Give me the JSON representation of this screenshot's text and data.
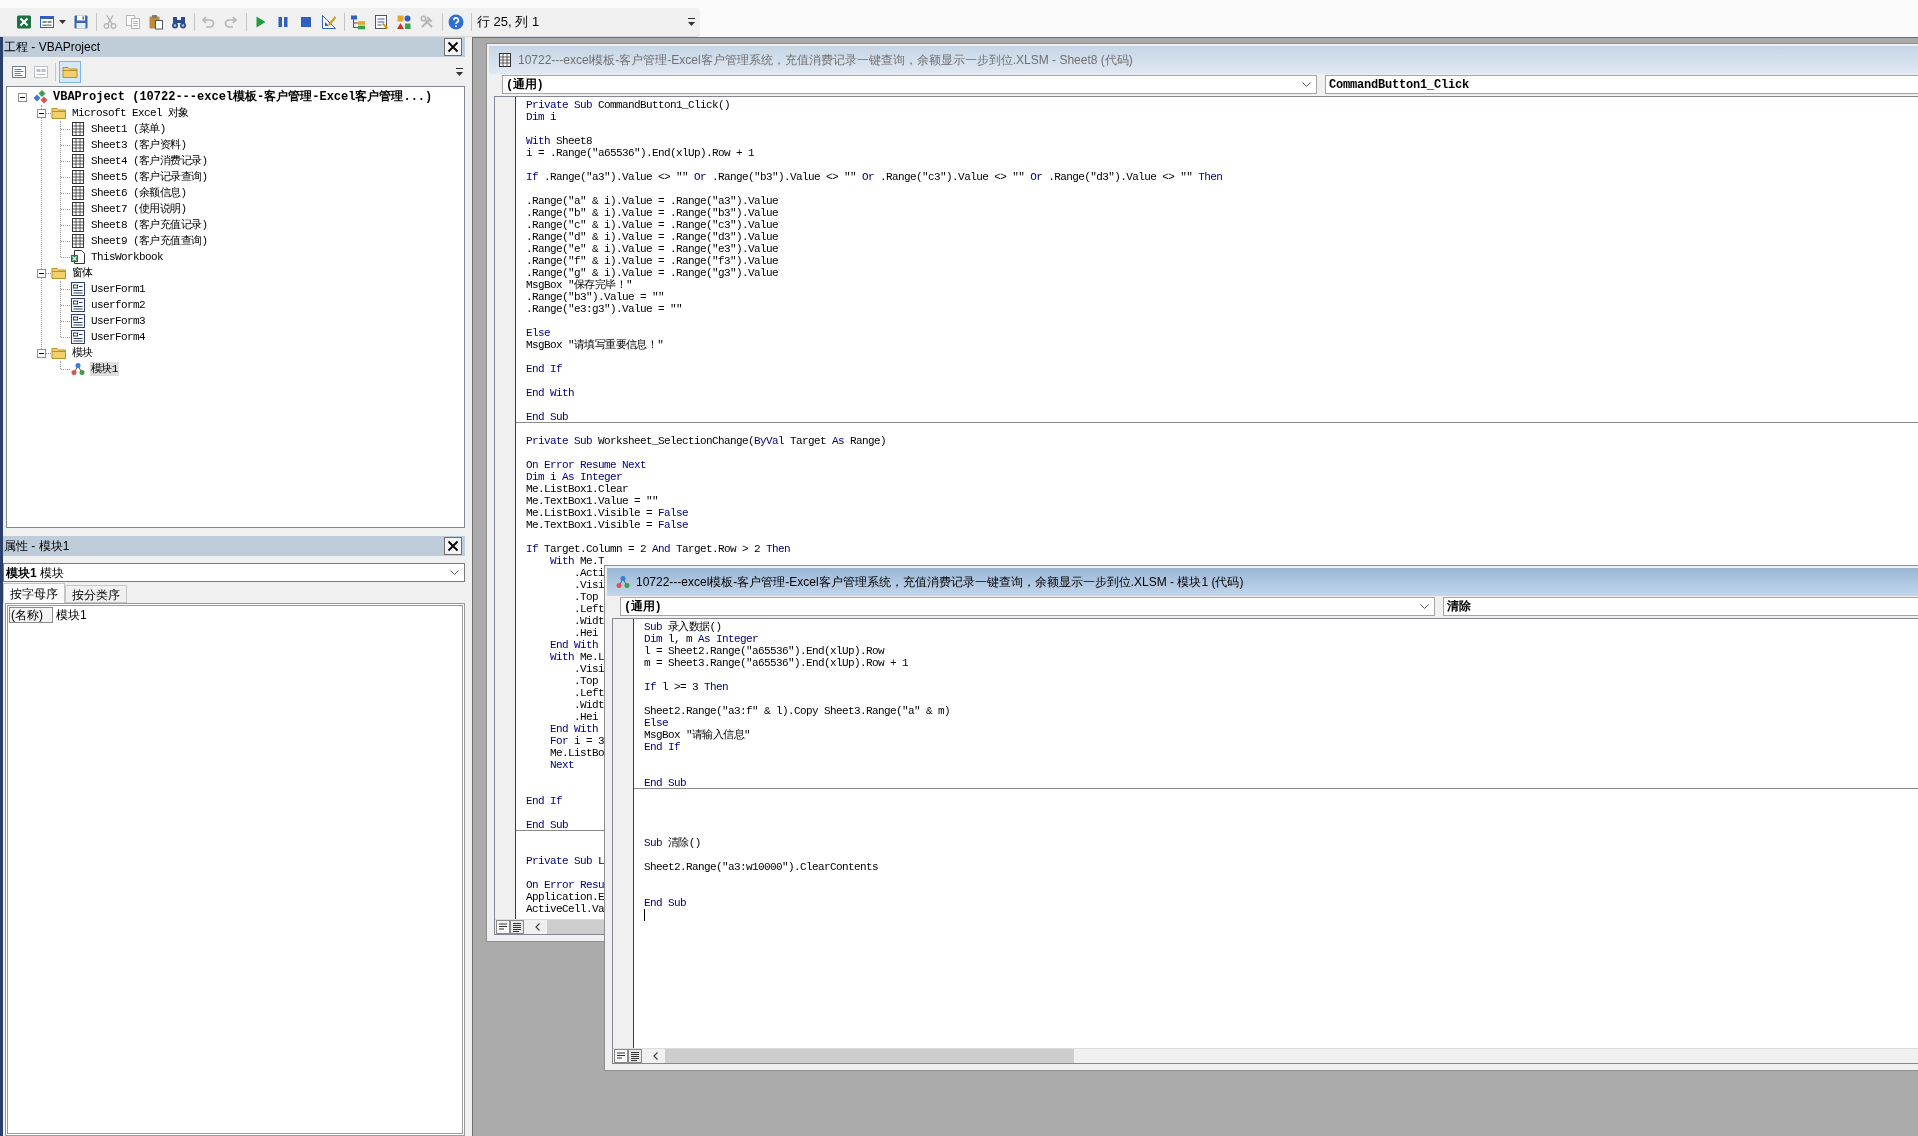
{
  "toolbar": {
    "groups": [
      {
        "buttons": [
          {
            "kind": "spreadsheet",
            "disabled": false
          },
          {
            "kind": "userform",
            "disabled": false
          },
          {
            "kind": "save",
            "disabled": false
          }
        ]
      },
      {
        "buttons": [
          {
            "kind": "cut",
            "disabled": true
          },
          {
            "kind": "copy",
            "disabled": true
          },
          {
            "kind": "paste",
            "disabled": false
          },
          {
            "kind": "find",
            "disabled": false
          }
        ]
      },
      {
        "buttons": [
          {
            "kind": "undo",
            "disabled": true
          },
          {
            "kind": "redo",
            "disabled": true
          }
        ]
      },
      {
        "buttons": [
          {
            "kind": "run",
            "disabled": false
          },
          {
            "kind": "pause",
            "disabled": false
          },
          {
            "kind": "stop",
            "disabled": false
          },
          {
            "kind": "design",
            "disabled": false
          }
        ]
      },
      {
        "buttons": [
          {
            "kind": "explorer",
            "disabled": false
          },
          {
            "kind": "properties",
            "disabled": false
          },
          {
            "kind": "browser",
            "disabled": false
          },
          {
            "kind": "toolbox",
            "disabled": true
          }
        ]
      },
      {
        "buttons": [
          {
            "kind": "help",
            "disabled": false
          }
        ]
      }
    ],
    "position": "行 25, 列 1"
  },
  "project_explorer": {
    "title": "工程 - VBAProject",
    "toolbar": [
      {
        "kind": "code",
        "disabled": false,
        "selected": false
      },
      {
        "kind": "object",
        "disabled": true,
        "selected": false
      },
      {
        "kind": "folders",
        "disabled": false,
        "selected": true
      }
    ],
    "tree": [
      {
        "kind": "project",
        "label": "VBAProject (10722---excel模板-客户管理-Excel客户管理...)",
        "selected": false,
        "expanded": true,
        "children": [
          {
            "kind": "folder",
            "label": "Microsoft Excel 对象",
            "selected": false,
            "expanded": true,
            "children": [
              {
                "kind": "sheet",
                "label": "Sheet1 (菜单)",
                "selected": false
              },
              {
                "kind": "sheet",
                "label": "Sheet3 (客户资料)",
                "selected": false
              },
              {
                "kind": "sheet",
                "label": "Sheet4 (客户消费记录)",
                "selected": false
              },
              {
                "kind": "sheet",
                "label": "Sheet5 (客户记录查询)",
                "selected": false
              },
              {
                "kind": "sheet",
                "label": "Sheet6 (余额信息)",
                "selected": false
              },
              {
                "kind": "sheet",
                "label": "Sheet7 (使用说明)",
                "selected": false
              },
              {
                "kind": "sheet",
                "label": "Sheet8 (客户充值记录)",
                "selected": false
              },
              {
                "kind": "sheet",
                "label": "Sheet9 (客户充值查询)",
                "selected": false
              },
              {
                "kind": "workbook",
                "label": "ThisWorkbook",
                "selected": false
              }
            ]
          },
          {
            "kind": "folder",
            "label": "窗体",
            "selected": false,
            "expanded": true,
            "children": [
              {
                "kind": "form",
                "label": "UserForm1",
                "selected": false
              },
              {
                "kind": "form",
                "label": "userform2",
                "selected": false
              },
              {
                "kind": "form",
                "label": "UserForm3",
                "selected": false
              },
              {
                "kind": "form",
                "label": "UserForm4",
                "selected": false
              }
            ]
          },
          {
            "kind": "folder",
            "label": "模块",
            "selected": false,
            "expanded": true,
            "children": [
              {
                "kind": "module",
                "label": "模块1",
                "selected": true
              }
            ]
          }
        ]
      }
    ]
  },
  "properties": {
    "title": "属性 - 模块1",
    "object": "**模块1** 模块",
    "tabs": [
      {
        "label": "按字母序",
        "selected": true
      },
      {
        "label": "按分类序",
        "selected": false
      }
    ],
    "rows": [
      {
        "name": "(名称)",
        "value": "模块1"
      }
    ]
  },
  "code_windows": [
    {
      "kind": "sheet",
      "title": "10722---excel模板-客户管理-Excel客户管理系统，充值消费记录一键查询，余额显示一步到位.XLSM - Sheet8 (代码)",
      "active": false,
      "object": "(通用)",
      "procedure": "CommandButton1_Click",
      "procedures": [
        {
          "lines": [
            {
              "kind": "code",
              "segments": [
                {
                  "kind": "keyword",
                  "text": "Private Sub"
                },
                {
                  "kind": "plain",
                  "text": " CommandButton1_Click()"
                }
              ]
            },
            {
              "kind": "code",
              "segments": [
                {
                  "kind": "keyword",
                  "text": "Dim"
                },
                {
                  "kind": "plain",
                  "text": " i"
                }
              ]
            },
            {
              "kind": "blank"
            },
            {
              "kind": "code",
              "segments": [
                {
                  "kind": "keyword",
                  "text": "With"
                },
                {
                  "kind": "plain",
                  "text": " Sheet8"
                }
              ]
            },
            {
              "kind": "code",
              "segments": [
                {
                  "kind": "plain",
                  "text": "i = .Range(\"a65536\").End(xlUp).Row + 1"
                }
              ]
            },
            {
              "kind": "blank"
            },
            {
              "kind": "code",
              "segments": [
                {
                  "kind": "keyword",
                  "text": "If"
                },
                {
                  "kind": "plain",
                  "text": " .Range(\"a3\").Value <> \"\" "
                },
                {
                  "kind": "keyword",
                  "text": "Or"
                },
                {
                  "kind": "plain",
                  "text": " .Range(\"b3\").Value <> \"\" "
                },
                {
                  "kind": "keyword",
                  "text": "Or"
                },
                {
                  "kind": "plain",
                  "text": " .Range(\"c3\").Value <> \"\" "
                },
                {
                  "kind": "keyword",
                  "text": "Or"
                },
                {
                  "kind": "plain",
                  "text": " .Range(\"d3\").Value <> \"\" "
                },
                {
                  "kind": "keyword",
                  "text": "Then"
                }
              ]
            },
            {
              "kind": "blank"
            },
            {
              "kind": "code",
              "segments": [
                {
                  "kind": "plain",
                  "text": ".Range(\"a\" & i).Value = .Range(\"a3\").Value"
                }
              ]
            },
            {
              "kind": "code",
              "segments": [
                {
                  "kind": "plain",
                  "text": ".Range(\"b\" & i).Value = .Range(\"b3\").Value"
                }
              ]
            },
            {
              "kind": "code",
              "segments": [
                {
                  "kind": "plain",
                  "text": ".Range(\"c\" & i).Value = .Range(\"c3\").Value"
                }
              ]
            },
            {
              "kind": "code",
              "segments": [
                {
                  "kind": "plain",
                  "text": ".Range(\"d\" & i).Value = .Range(\"d3\").Value"
                }
              ]
            },
            {
              "kind": "code",
              "segments": [
                {
                  "kind": "plain",
                  "text": ".Range(\"e\" & i).Value = .Range(\"e3\").Value"
                }
              ]
            },
            {
              "kind": "code",
              "segments": [
                {
                  "kind": "plain",
                  "text": ".Range(\"f\" & i).Value = .Range(\"f3\").Value"
                }
              ]
            },
            {
              "kind": "code",
              "segments": [
                {
                  "kind": "plain",
                  "text": ".Range(\"g\" & i).Value = .Range(\"g3\").Value"
                }
              ]
            },
            {
              "kind": "code",
              "segments": [
                {
                  "kind": "plain",
                  "text": "MsgBox \"保存完毕！\""
                }
              ]
            },
            {
              "kind": "code",
              "segments": [
                {
                  "kind": "plain",
                  "text": ".Range(\"b3\").Value = \"\""
                }
              ]
            },
            {
              "kind": "code",
              "segments": [
                {
                  "kind": "plain",
                  "text": ".Range(\"e3:g3\").Value = \"\""
                }
              ]
            },
            {
              "kind": "blank"
            },
            {
              "kind": "code",
              "segments": [
                {
                  "kind": "keyword",
                  "text": "Else"
                }
              ]
            },
            {
              "kind": "code",
              "segments": [
                {
                  "kind": "plain",
                  "text": "MsgBox \"请填写重要信息！\""
                }
              ]
            },
            {
              "kind": "blank"
            },
            {
              "kind": "code",
              "segments": [
                {
                  "kind": "keyword",
                  "text": "End If"
                }
              ]
            },
            {
              "kind": "blank"
            },
            {
              "kind": "code",
              "segments": [
                {
                  "kind": "keyword",
                  "text": "End With"
                }
              ]
            },
            {
              "kind": "blank"
            },
            {
              "kind": "code",
              "segments": [
                {
                  "kind": "keyword",
                  "text": "End Sub"
                }
              ]
            }
          ]
        },
        {
          "lines": [
            {
              "kind": "blank"
            },
            {
              "kind": "code",
              "segments": [
                {
                  "kind": "keyword",
                  "text": "Private Sub"
                },
                {
                  "kind": "plain",
                  "text": " Worksheet_SelectionChange("
                },
                {
                  "kind": "keyword",
                  "text": "ByVal"
                },
                {
                  "kind": "plain",
                  "text": " Target "
                },
                {
                  "kind": "keyword",
                  "text": "As"
                },
                {
                  "kind": "plain",
                  "text": " Range)"
                }
              ]
            },
            {
              "kind": "blank"
            },
            {
              "kind": "code",
              "segments": [
                {
                  "kind": "keyword",
                  "text": "On Error Resume Next"
                }
              ]
            },
            {
              "kind": "code",
              "segments": [
                {
                  "kind": "keyword",
                  "text": "Dim"
                },
                {
                  "kind": "plain",
                  "text": " i "
                },
                {
                  "kind": "keyword",
                  "text": "As Integer"
                }
              ]
            },
            {
              "kind": "code",
              "segments": [
                {
                  "kind": "plain",
                  "text": "Me.ListBox1.Clear"
                }
              ]
            },
            {
              "kind": "code",
              "segments": [
                {
                  "kind": "plain",
                  "text": "Me.TextBox1.Value = \"\""
                }
              ]
            },
            {
              "kind": "code",
              "segments": [
                {
                  "kind": "plain",
                  "text": "Me.ListBox1.Visible = "
                },
                {
                  "kind": "keyword",
                  "text": "False"
                }
              ]
            },
            {
              "kind": "code",
              "segments": [
                {
                  "kind": "plain",
                  "text": "Me.TextBox1.Visible = "
                },
                {
                  "kind": "keyword",
                  "text": "False"
                }
              ]
            },
            {
              "kind": "blank"
            },
            {
              "kind": "code",
              "segments": [
                {
                  "kind": "keyword",
                  "text": "If"
                },
                {
                  "kind": "plain",
                  "text": " Target.Column = 2 "
                },
                {
                  "kind": "keyword",
                  "text": "And"
                },
                {
                  "kind": "plain",
                  "text": " Target.Row > 2 "
                },
                {
                  "kind": "keyword",
                  "text": "Then"
                }
              ],
              "children": [
                {
                  "kind": "code",
                  "segments": [
                    {
                      "kind": "keyword",
                      "text": "With"
                    },
                    {
                      "kind": "plain",
                      "text": " Me.T"
                    }
                  ],
                  "children": [
                    {
                      "kind": "code",
                      "segments": [
                        {
                          "kind": "plain",
                          "text": ".Acti"
                        }
                      ]
                    },
                    {
                      "kind": "code",
                      "segments": [
                        {
                          "kind": "plain",
                          "text": ".Visi"
                        }
                      ]
                    },
                    {
                      "kind": "code",
                      "segments": [
                        {
                          "kind": "plain",
                          "text": ".Top"
                        }
                      ]
                    },
                    {
                      "kind": "code",
                      "segments": [
                        {
                          "kind": "plain",
                          "text": ".Left"
                        }
                      ]
                    },
                    {
                      "kind": "code",
                      "segments": [
                        {
                          "kind": "plain",
                          "text": ".Widt"
                        }
                      ]
                    },
                    {
                      "kind": "code",
                      "segments": [
                        {
                          "kind": "plain",
                          "text": ".Hei"
                        }
                      ]
                    }
                  ]
                },
                {
                  "kind": "code",
                  "segments": [
                    {
                      "kind": "keyword",
                      "text": "End With"
                    }
                  ]
                },
                {
                  "kind": "code",
                  "segments": [
                    {
                      "kind": "keyword",
                      "text": "With"
                    },
                    {
                      "kind": "plain",
                      "text": " Me.L"
                    }
                  ],
                  "children": [
                    {
                      "kind": "code",
                      "segments": [
                        {
                          "kind": "plain",
                          "text": ".Visi"
                        }
                      ]
                    },
                    {
                      "kind": "code",
                      "segments": [
                        {
                          "kind": "plain",
                          "text": ".Top"
                        }
                      ]
                    },
                    {
                      "kind": "code",
                      "segments": [
                        {
                          "kind": "plain",
                          "text": ".Left"
                        }
                      ]
                    },
                    {
                      "kind": "code",
                      "segments": [
                        {
                          "kind": "plain",
                          "text": ".Widt"
                        }
                      ]
                    },
                    {
                      "kind": "code",
                      "segments": [
                        {
                          "kind": "plain",
                          "text": ".Hei"
                        }
                      ]
                    }
                  ]
                },
                {
                  "kind": "code",
                  "segments": [
                    {
                      "kind": "keyword",
                      "text": "End With"
                    }
                  ]
                },
                {
                  "kind": "code",
                  "segments": [
                    {
                      "kind": "keyword",
                      "text": "For"
                    },
                    {
                      "kind": "plain",
                      "text": " i = 3"
                    }
                  ]
                },
                {
                  "kind": "code",
                  "segments": [
                    {
                      "kind": "plain",
                      "text": "Me.ListBo"
                    }
                  ]
                },
                {
                  "kind": "code",
                  "segments": [
                    {
                      "kind": "keyword",
                      "text": "Next"
                    }
                  ]
                }
              ]
            },
            {
              "kind": "blank"
            },
            {
              "kind": "blank"
            },
            {
              "kind": "code",
              "segments": [
                {
                  "kind": "keyword",
                  "text": "End If"
                }
              ]
            },
            {
              "kind": "blank"
            },
            {
              "kind": "code",
              "segments": [
                {
                  "kind": "keyword",
                  "text": "End Sub"
                }
              ]
            }
          ]
        },
        {
          "lines": [
            {
              "kind": "blank"
            },
            {
              "kind": "blank"
            },
            {
              "kind": "code",
              "segments": [
                {
                  "kind": "keyword",
                  "text": "Private Sub"
                },
                {
                  "kind": "plain",
                  "text": " L"
                }
              ]
            },
            {
              "kind": "blank"
            },
            {
              "kind": "code",
              "segments": [
                {
                  "kind": "keyword",
                  "text": "On Error Resu"
                }
              ]
            },
            {
              "kind": "code",
              "segments": [
                {
                  "kind": "plain",
                  "text": "Application.E"
                }
              ]
            },
            {
              "kind": "code",
              "segments": [
                {
                  "kind": "plain",
                  "text": "ActiveCell.Va"
                }
              ]
            }
          ]
        }
      ]
    },
    {
      "kind": "module",
      "title": "10722---excel模板-客户管理-Excel客户管理系统，充值消费记录一键查询，余额显示一步到位.XLSM - 模块1 (代码)",
      "active": true,
      "object": "(通用)",
      "procedure": "清除",
      "procedures": [
        {
          "lines": [
            {
              "kind": "code",
              "segments": [
                {
                  "kind": "keyword",
                  "text": "Sub"
                },
                {
                  "kind": "plain",
                  "text": " 录入数据()"
                }
              ]
            },
            {
              "kind": "code",
              "segments": [
                {
                  "kind": "keyword",
                  "text": "Dim"
                },
                {
                  "kind": "plain",
                  "text": " l, m "
                },
                {
                  "kind": "keyword",
                  "text": "As Integer"
                }
              ]
            },
            {
              "kind": "code",
              "segments": [
                {
                  "kind": "plain",
                  "text": "l = Sheet2.Range(\"a65536\").End(xlUp).Row"
                }
              ]
            },
            {
              "kind": "code",
              "segments": [
                {
                  "kind": "plain",
                  "text": "m = Sheet3.Range(\"a65536\").End(xlUp).Row + 1"
                }
              ]
            },
            {
              "kind": "blank"
            },
            {
              "kind": "code",
              "segments": [
                {
                  "kind": "keyword",
                  "text": "If"
                },
                {
                  "kind": "plain",
                  "text": " l >= 3 "
                },
                {
                  "kind": "keyword",
                  "text": "Then"
                }
              ]
            },
            {
              "kind": "blank"
            },
            {
              "kind": "code",
              "segments": [
                {
                  "kind": "plain",
                  "text": "Sheet2.Range(\"a3:f\" & l).Copy Sheet3.Range(\"a\" & m)"
                }
              ]
            },
            {
              "kind": "code",
              "segments": [
                {
                  "kind": "keyword",
                  "text": "Else"
                }
              ]
            },
            {
              "kind": "code",
              "segments": [
                {
                  "kind": "plain",
                  "text": "MsgBox \"请输入信息\""
                }
              ]
            },
            {
              "kind": "code",
              "segments": [
                {
                  "kind": "keyword",
                  "text": "End If"
                }
              ]
            },
            {
              "kind": "blank"
            },
            {
              "kind": "blank"
            },
            {
              "kind": "code",
              "segments": [
                {
                  "kind": "keyword",
                  "text": "End Sub"
                }
              ]
            }
          ]
        },
        {
          "lines": [
            {
              "kind": "blank"
            },
            {
              "kind": "blank"
            },
            {
              "kind": "blank"
            },
            {
              "kind": "blank"
            },
            {
              "kind": "code",
              "segments": [
                {
                  "kind": "keyword",
                  "text": "Sub"
                },
                {
                  "kind": "plain",
                  "text": " 清除()"
                }
              ]
            },
            {
              "kind": "blank"
            },
            {
              "kind": "code",
              "segments": [
                {
                  "kind": "plain",
                  "text": "Sheet2.Range(\"a3:w10000\").ClearContents"
                }
              ]
            },
            {
              "kind": "blank"
            },
            {
              "kind": "blank"
            },
            {
              "kind": "code",
              "segments": [
                {
                  "kind": "keyword",
                  "text": "End Sub"
                }
              ]
            },
            {
              "kind": "caret"
            }
          ]
        }
      ]
    }
  ]
}
